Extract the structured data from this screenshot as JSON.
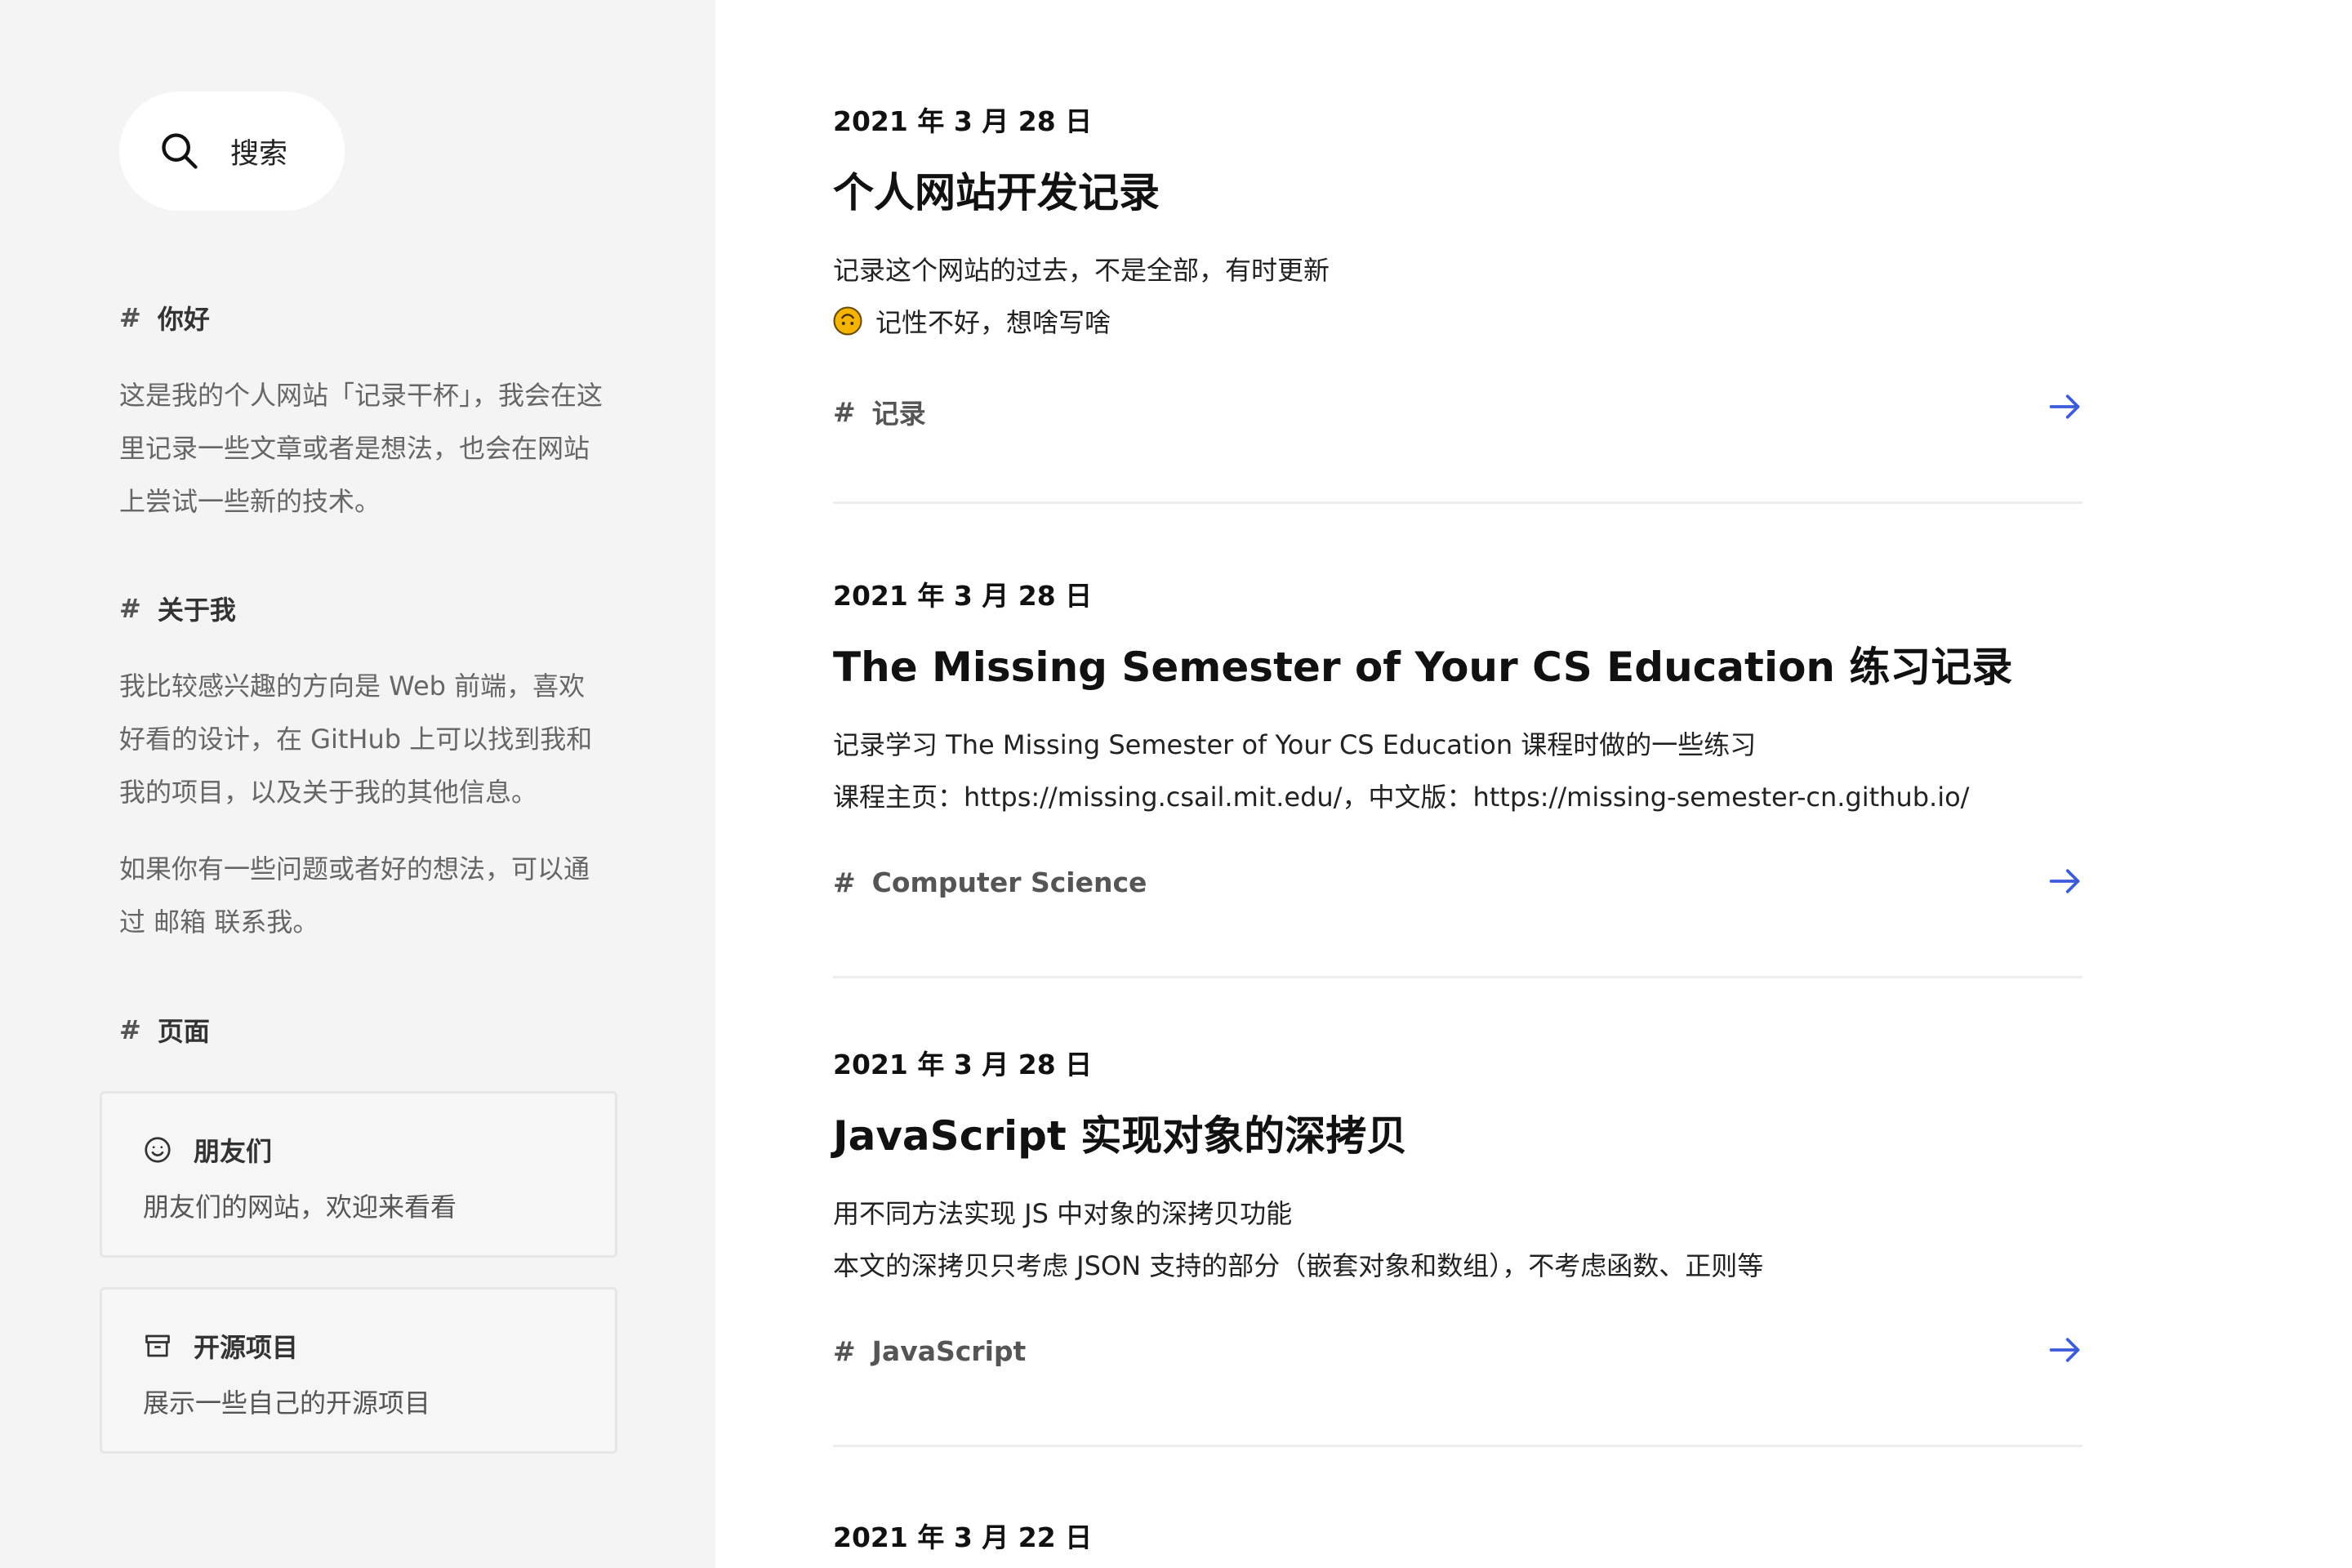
{
  "sidebar": {
    "search_label": "搜索",
    "sections": [
      {
        "heading": "你好",
        "paragraphs": [
          "这是我的个人网站「记录干杯」，我会在这里记录一些文章或者是想法，也会在网站上尝试一些新的技术。"
        ]
      },
      {
        "heading": "关于我",
        "paragraphs": [
          "我比较感兴趣的方向是 Web 前端，喜欢好看的设计，在 GitHub 上可以找到我和我的项目，以及关于我的其他信息。",
          "如果你有一些问题或者好的想法，可以通过 邮箱 联系我。"
        ]
      },
      {
        "heading": "页面"
      }
    ],
    "hash": "#",
    "pages": [
      {
        "title": "朋友们",
        "desc": "朋友们的网站，欢迎来看看",
        "icon": "smiley-icon"
      },
      {
        "title": "开源项目",
        "desc": "展示一些自己的开源项目",
        "icon": "archive-icon"
      }
    ]
  },
  "posts": [
    {
      "date": "2021 年 3 月 28 日",
      "title": "个人网站开发记录",
      "lines": [
        "记录这个网站的过去，不是全部，有时更新",
        "记性不好，想啥写啥"
      ],
      "tag": "记录"
    },
    {
      "date": "2021 年 3 月 28 日",
      "title": "The Missing Semester of Your CS Education 练习记录",
      "lines": [
        "记录学习 The Missing Semester of Your CS Education 课程时做的一些练习",
        "课程主页：https://missing.csail.mit.edu/，中文版：https://missing-semester-cn.github.io/"
      ],
      "tag": "Computer Science"
    },
    {
      "date": "2021 年 3 月 28 日",
      "title": "JavaScript 实现对象的深拷贝",
      "lines": [
        "用不同方法实现 JS 中对象的深拷贝功能",
        "本文的深拷贝只考虑 JSON 支持的部分（嵌套对象和数组），不考虑函数、正则等"
      ],
      "tag": "JavaScript"
    },
    {
      "date": "2021 年 3 月 22 日"
    }
  ],
  "colors": {
    "sidebar_bg": "#f4f4f4",
    "arrow_accent": "#3b5bdb",
    "emoji_yellow": "#f4b400"
  }
}
